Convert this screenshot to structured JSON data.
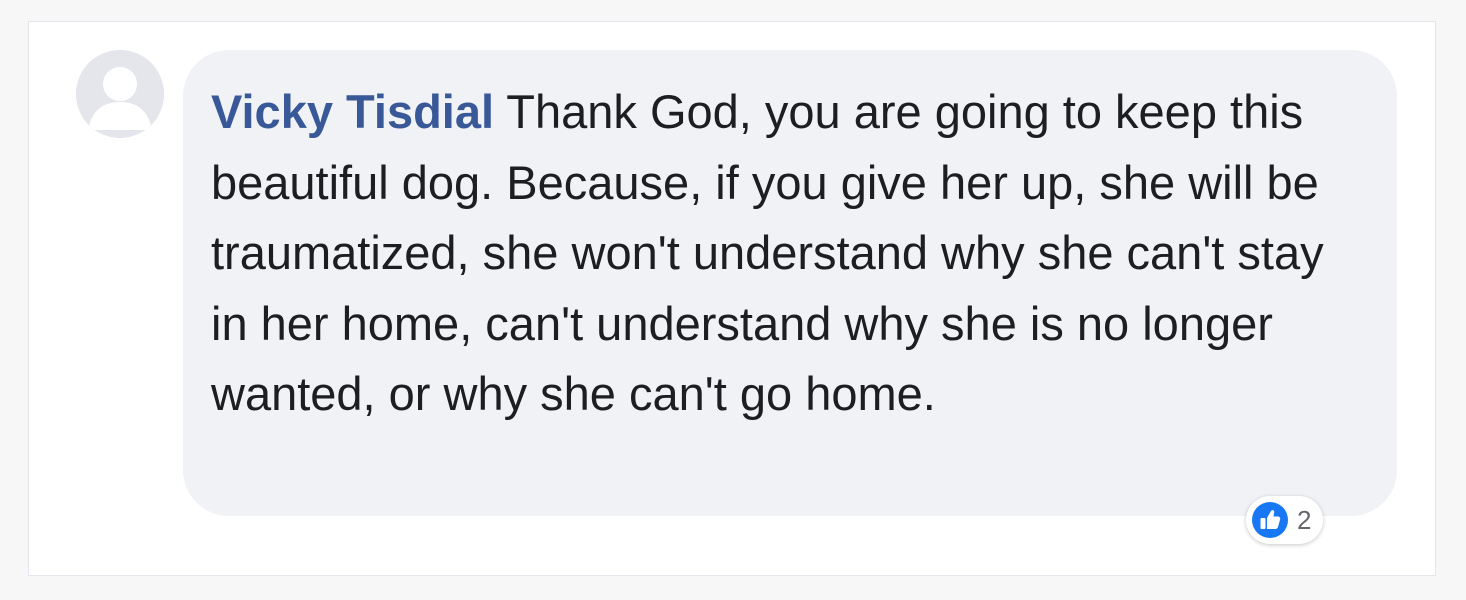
{
  "comment": {
    "author_name": "Vicky Tisdial",
    "text": " Thank God, you are going to keep this beautiful dog. Because, if you give her up, she will be traumatized, she won't understand why she can't stay in her home, can't understand why she is no longer wanted, or why she can't go home."
  },
  "reactions": {
    "type_icon": "like-icon",
    "count": "2",
    "color": "#1877f2"
  },
  "colors": {
    "author": "#385898",
    "bubble": "#f0f2f5",
    "text": "#1c1e21"
  },
  "avatar": {
    "icon": "default-profile-silhouette"
  }
}
